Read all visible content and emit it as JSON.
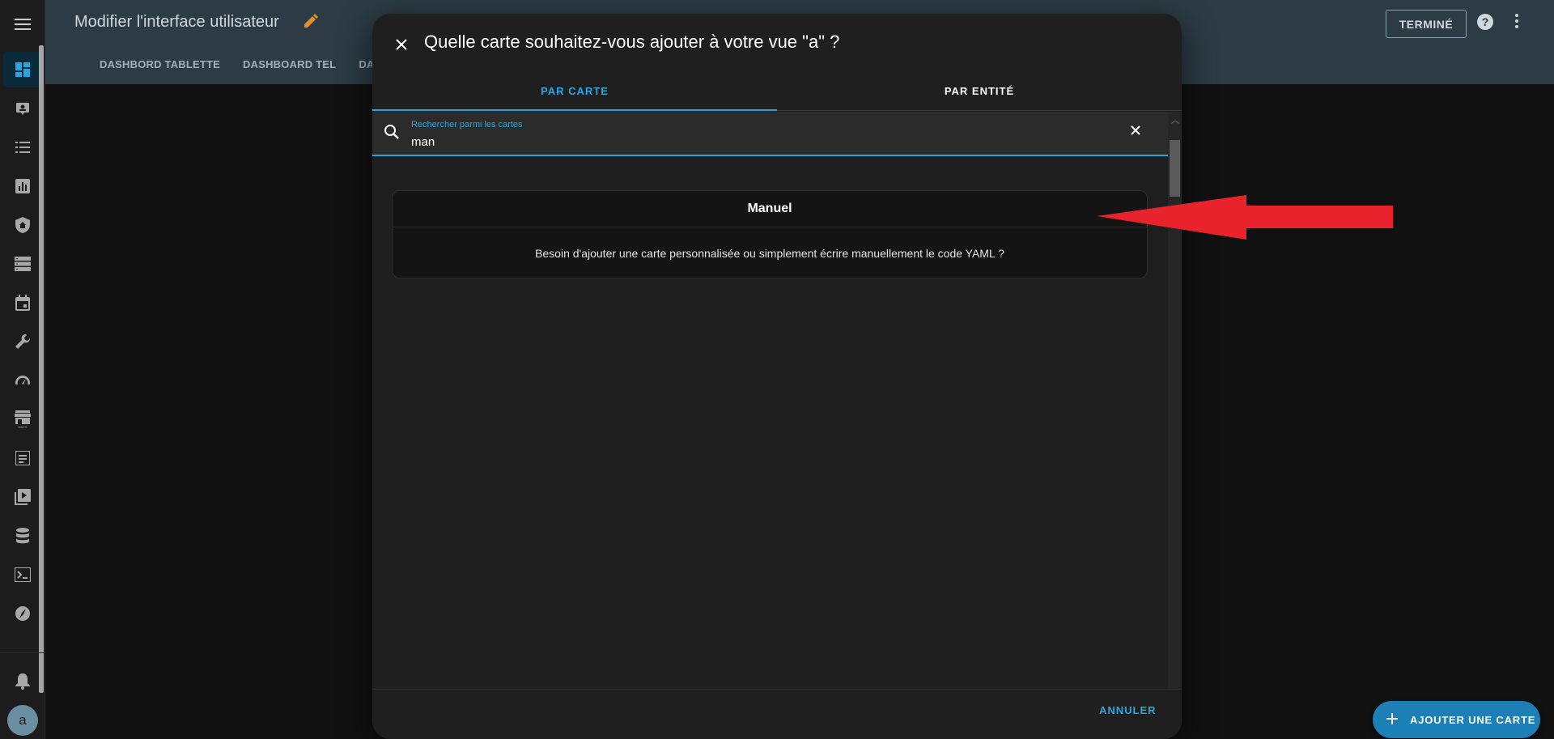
{
  "header": {
    "title": "Modifier l'interface utilisateur",
    "tabs": [
      "DASHBORD TABLETTE",
      "DASHBOARD TEL",
      "DASH"
    ],
    "done_label": "TERMINÉ"
  },
  "sidebar": {
    "items": [
      {
        "icon": "dashboard-icon",
        "active": true
      },
      {
        "icon": "map-icon"
      },
      {
        "icon": "logbook-icon"
      },
      {
        "icon": "history-icon"
      },
      {
        "icon": "shield-home-icon"
      },
      {
        "icon": "server-icon"
      },
      {
        "icon": "calendar-icon"
      },
      {
        "icon": "wrench-icon"
      },
      {
        "icon": "speedometer-icon"
      },
      {
        "icon": "hacs-store-icon"
      },
      {
        "icon": "log-icon"
      },
      {
        "icon": "media-icon"
      },
      {
        "icon": "database-icon"
      },
      {
        "icon": "terminal-icon"
      },
      {
        "icon": "compass-icon"
      }
    ],
    "avatar_initial": "a"
  },
  "dialog": {
    "title": "Quelle carte souhaitez-vous ajouter à votre vue \"a\" ?",
    "tabs": [
      {
        "label": "PAR CARTE",
        "active": true
      },
      {
        "label": "PAR ENTITÉ",
        "active": false
      }
    ],
    "search": {
      "label": "Rechercher parmi les cartes",
      "value": "man"
    },
    "card": {
      "title": "Manuel",
      "description": "Besoin d'ajouter une carte personnalisée ou simplement écrire manuellement le code YAML ?"
    },
    "cancel_label": "ANNULER"
  },
  "fab": {
    "label": "AJOUTER UNE CARTE"
  },
  "colors": {
    "accent": "#2aa6df",
    "header_bg": "#2c3b44",
    "arrow": "#e8232b",
    "fab": "#1c7fb6"
  }
}
